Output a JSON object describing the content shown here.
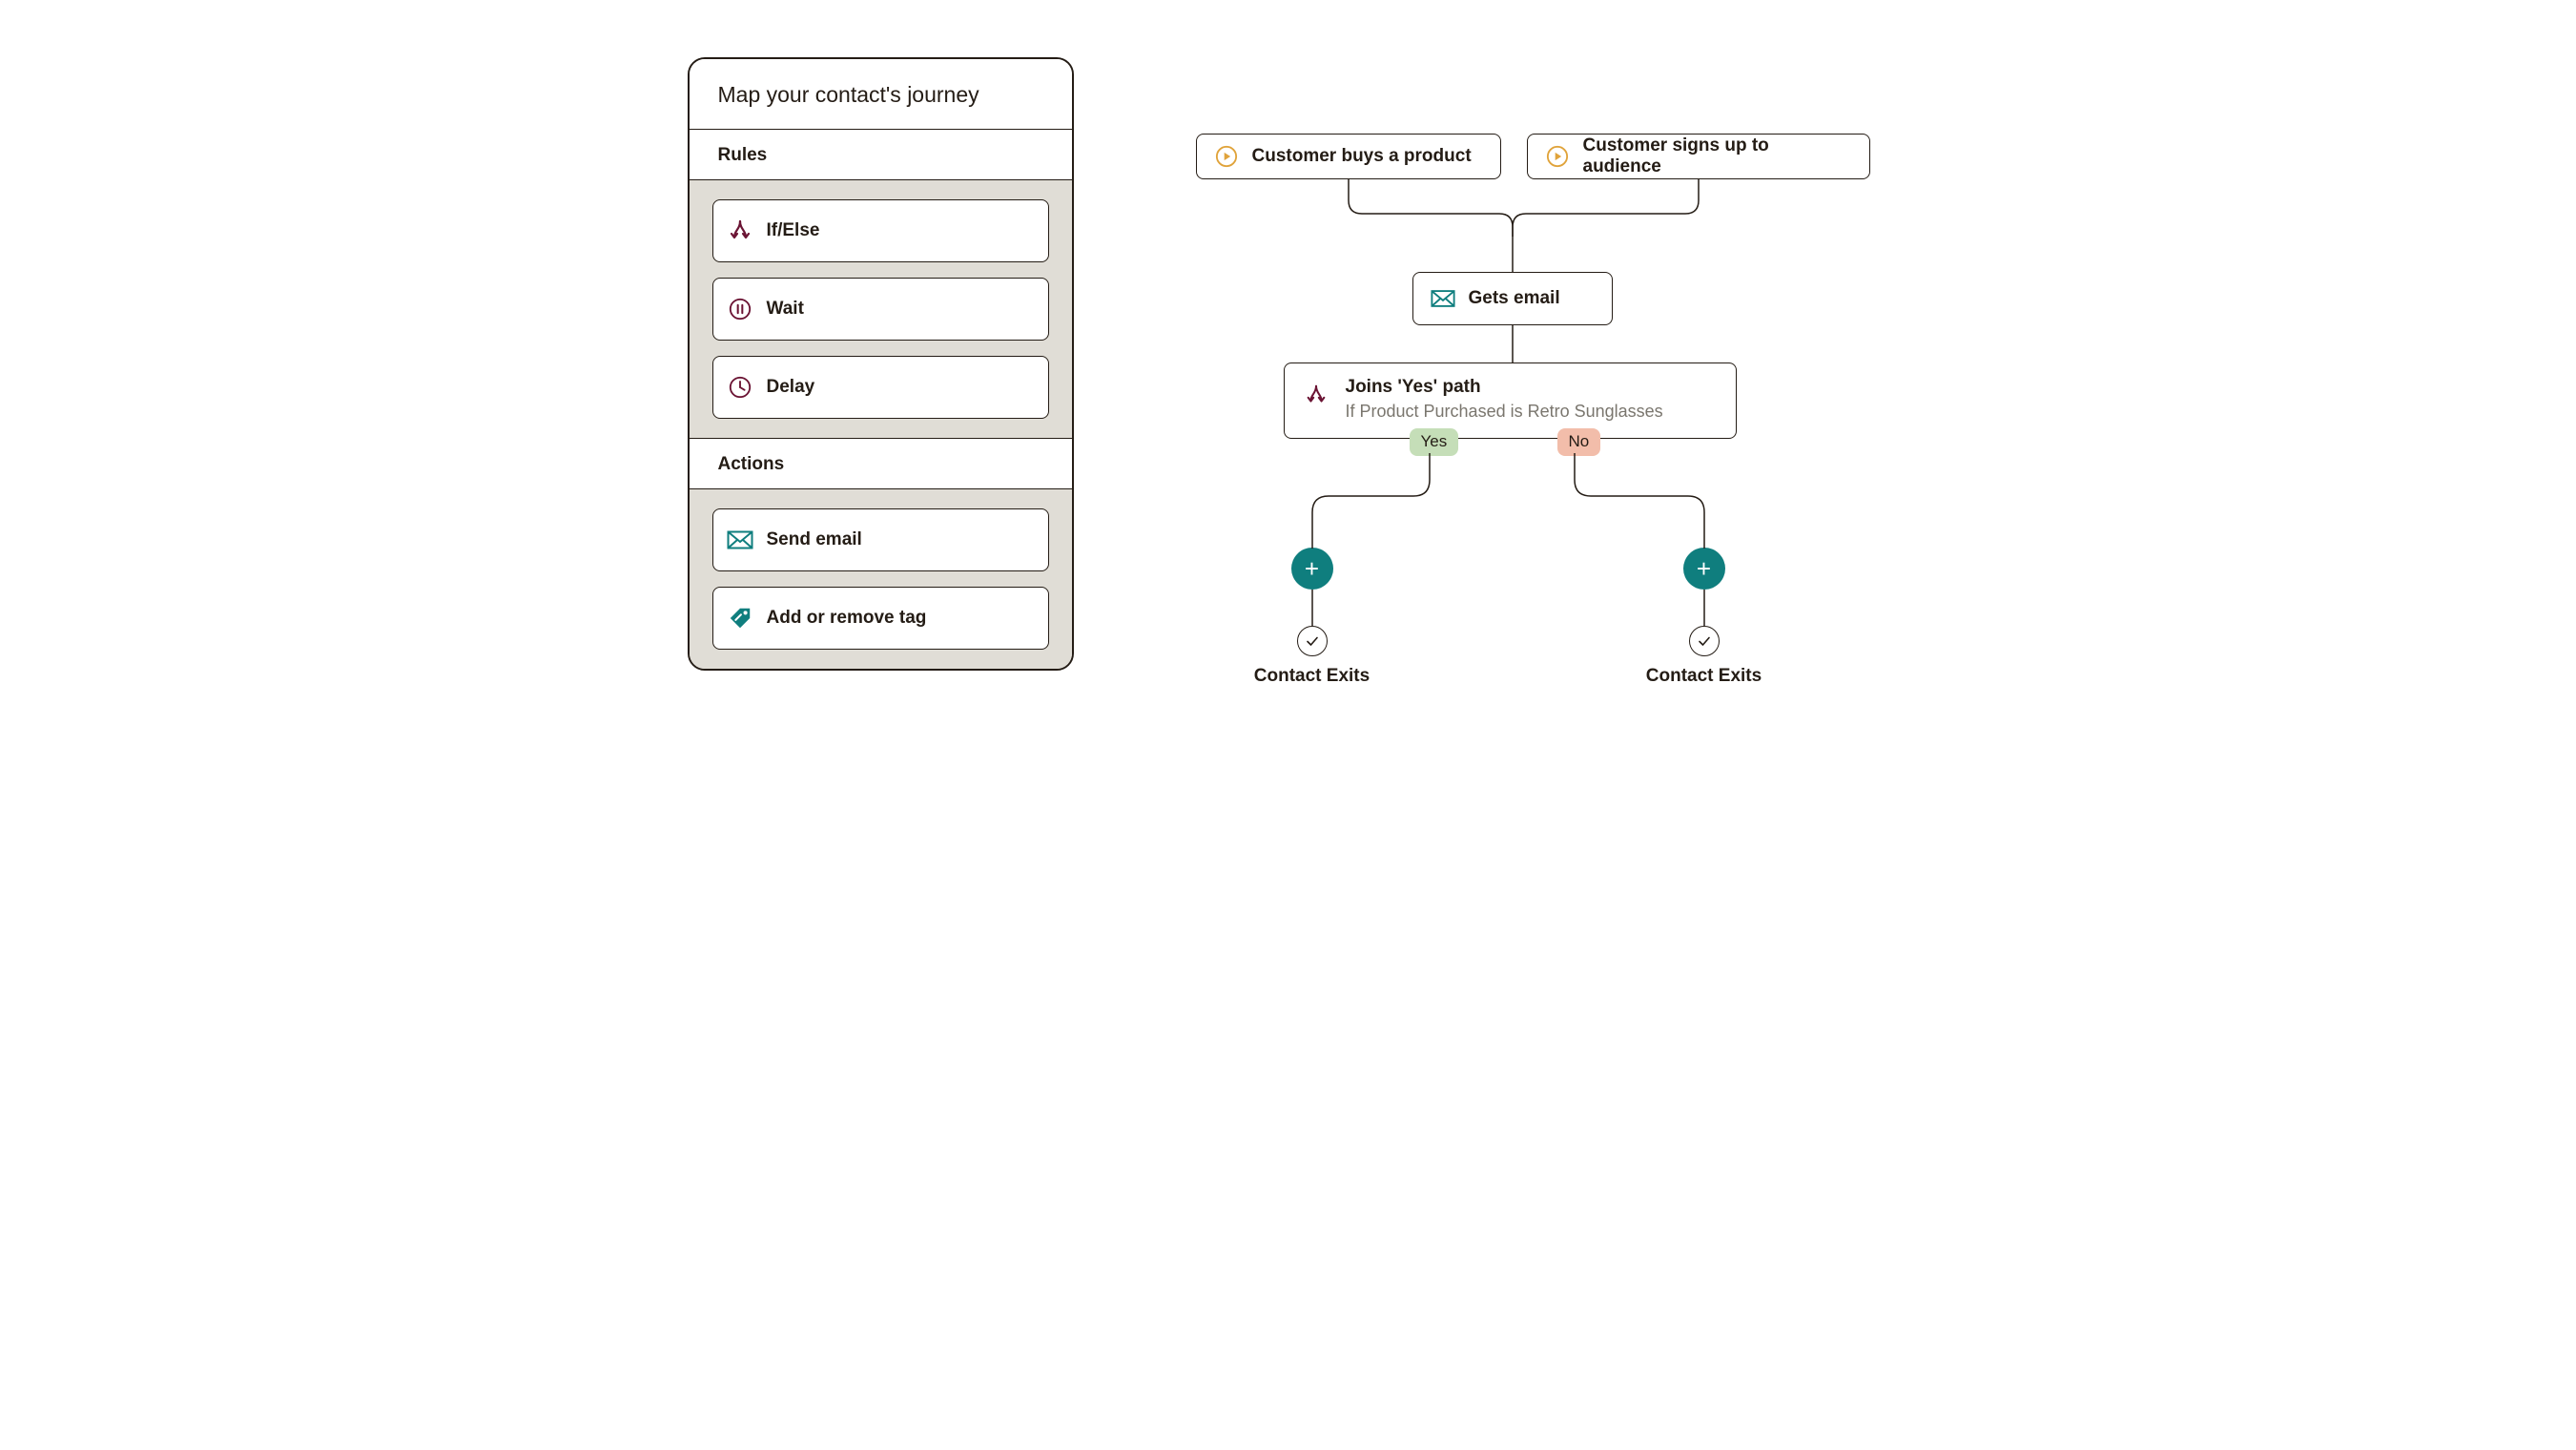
{
  "panel": {
    "title": "Map your contact's journey",
    "rules": {
      "header": "Rules",
      "items": [
        {
          "id": "if-else",
          "label": "If/Else",
          "icon": "branch-icon"
        },
        {
          "id": "wait",
          "label": "Wait",
          "icon": "pause-icon"
        },
        {
          "id": "delay",
          "label": "Delay",
          "icon": "clock-icon"
        }
      ]
    },
    "actions": {
      "header": "Actions",
      "items": [
        {
          "id": "send-email",
          "label": "Send email",
          "icon": "mail-icon"
        },
        {
          "id": "tag",
          "label": "Add or remove tag",
          "icon": "tag-icon"
        }
      ]
    }
  },
  "flow": {
    "triggers": [
      {
        "label": "Customer buys a product"
      },
      {
        "label": "Customer signs up to audience"
      }
    ],
    "email": {
      "label": "Gets email"
    },
    "branch": {
      "title": "Joins 'Yes' path",
      "subtitle": "If Product Purchased is Retro Sunglasses",
      "yes": "Yes",
      "no": "No"
    },
    "exit_label": "Contact Exits"
  },
  "colors": {
    "accent_teal": "#0F7E7E",
    "maroon": "#6B1434",
    "amber": "#E0A33A",
    "panel_bg": "#E0DDD6",
    "yes_badge": "#C5DEB8",
    "no_badge": "#F2BDAA"
  }
}
